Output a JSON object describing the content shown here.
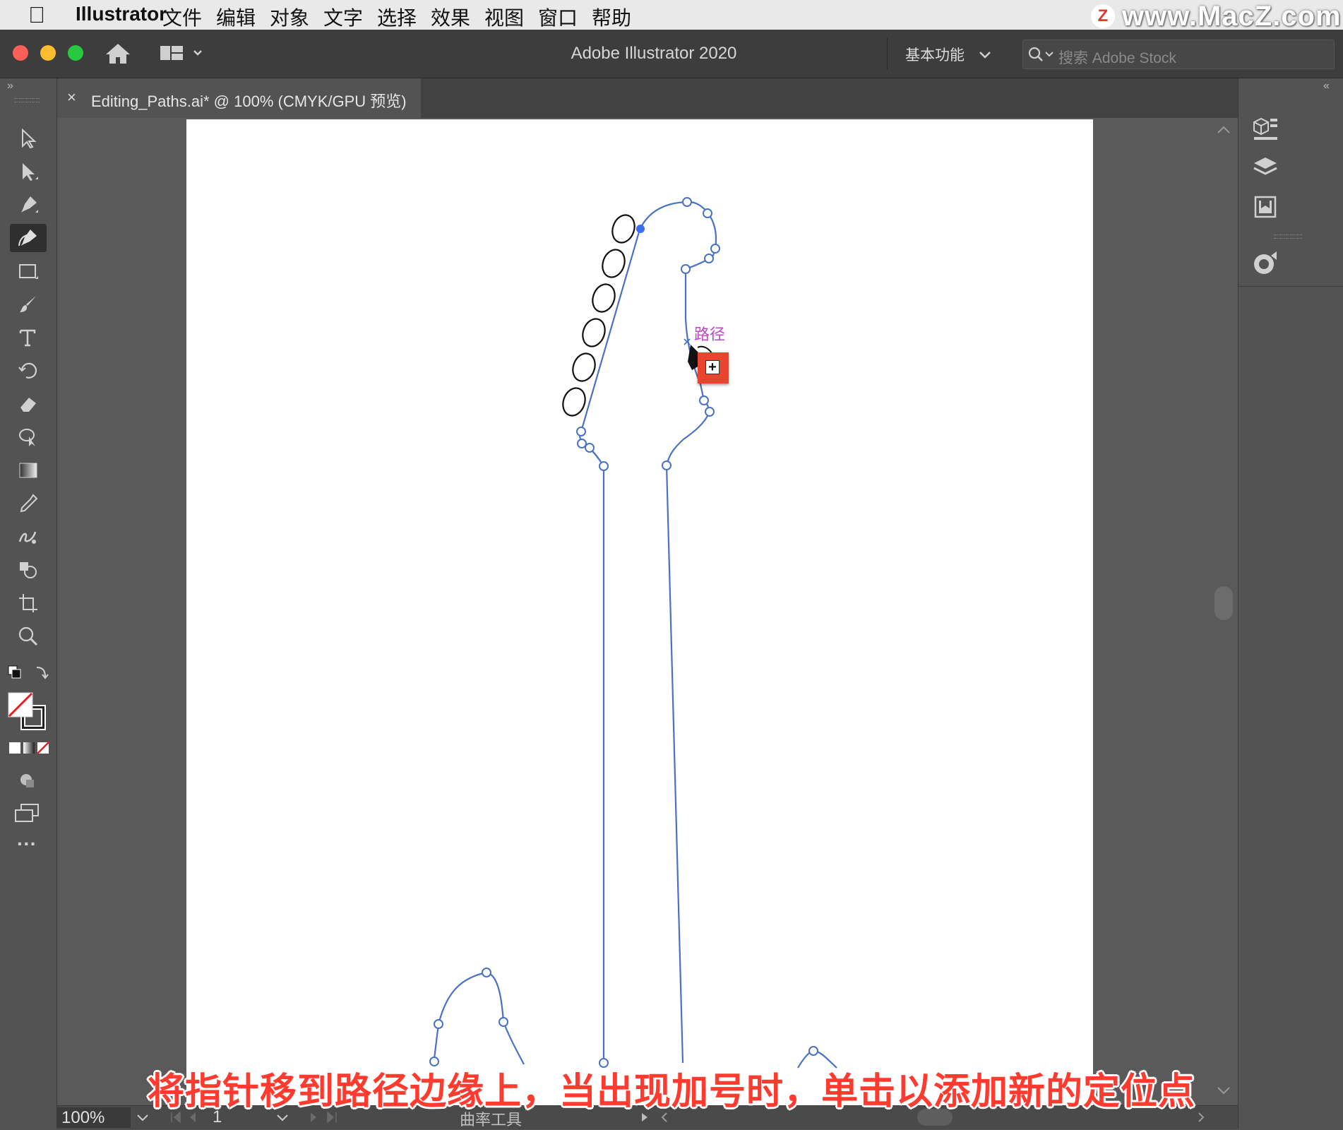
{
  "menubar": {
    "app_name": "Illustrator",
    "items": [
      "文件",
      "编辑",
      "对象",
      "文字",
      "选择",
      "效果",
      "视图",
      "窗口",
      "帮助"
    ],
    "watermark": "www.MacZ.com",
    "watermark_badge": "Z"
  },
  "titlebar": {
    "title": "Adobe Illustrator 2020",
    "workspace_label": "基本功能",
    "search_placeholder": "搜索 Adobe Stock"
  },
  "document_tab": {
    "close_label": "×",
    "name": "Editing_Paths.ai* @ 100% (CMYK/GPU 预览)"
  },
  "canvas": {
    "path_hint_label": "路径",
    "cursor_badge": "+"
  },
  "statusbar": {
    "zoom": "100%",
    "page": "1",
    "tool_name": "曲率工具"
  },
  "subtitle": "将指针移到路径边缘上，当出现加号时，单击以添加新的定位点",
  "colors": {
    "menubar_bg": "#e9e9ea",
    "ui_dark": "#3d3d3d",
    "panel": "#535353",
    "path_blue": "#4a72c4",
    "anchor_active": "#3b6ef0",
    "hint_magenta": "#c447c9",
    "subtitle_red": "#ff3b30",
    "traffic_red": "#fe5f57",
    "traffic_yellow": "#febc2e",
    "traffic_green": "#28c840"
  },
  "icons": {
    "toolbar": [
      "selection-tool-icon",
      "direct-selection-tool-icon",
      "pen-tool-icon",
      "curvature-tool-icon",
      "rectangle-tool-icon",
      "paintbrush-tool-icon",
      "type-tool-icon",
      "rotate-tool-icon",
      "eraser-tool-icon",
      "puppet-warp-tool-icon",
      "gradient-tool-icon",
      "eyedropper-tool-icon",
      "symbol-sprayer-tool-icon",
      "shape-builder-tool-icon",
      "artboard-tool-icon",
      "zoom-tool-icon"
    ],
    "right_panel": [
      "libraries-panel-icon",
      "layers-panel-icon",
      "artboards-panel-icon",
      "appearance-panel-icon"
    ]
  }
}
